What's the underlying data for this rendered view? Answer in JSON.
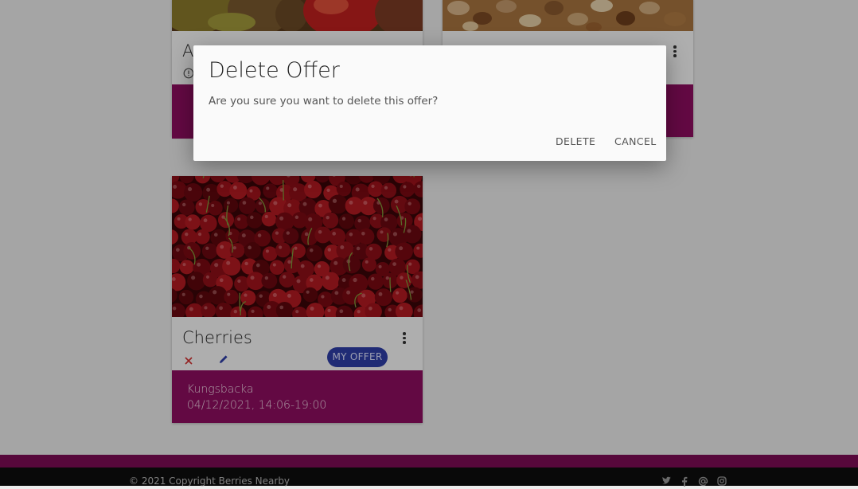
{
  "dialog": {
    "title": "Delete Offer",
    "message": "Are you sure you want to delete this offer?",
    "delete_label": "DELETE",
    "cancel_label": "CANCEL"
  },
  "cards": [
    {
      "title": "A",
      "image": "fruit-photo"
    },
    {
      "title": "",
      "image": "nuts-photo"
    },
    {
      "title": "Cherries",
      "image": "cherries-photo",
      "badge": "MY OFFER",
      "location": "Kungsbacka",
      "datetime": "04/12/2021, 14:06-19:00"
    }
  ],
  "footer": {
    "copyright": "© 2021 Copyright Berries Nearby",
    "social_icons": [
      "twitter-icon",
      "facebook-icon",
      "at-icon",
      "instagram-icon"
    ]
  },
  "colors": {
    "accent": "#8f0e61",
    "badge": "#2f3ea8",
    "delete_icon": "#d32f2f",
    "edit_icon": "#2f3ea8",
    "footer_dark": "#0d0d0d"
  }
}
